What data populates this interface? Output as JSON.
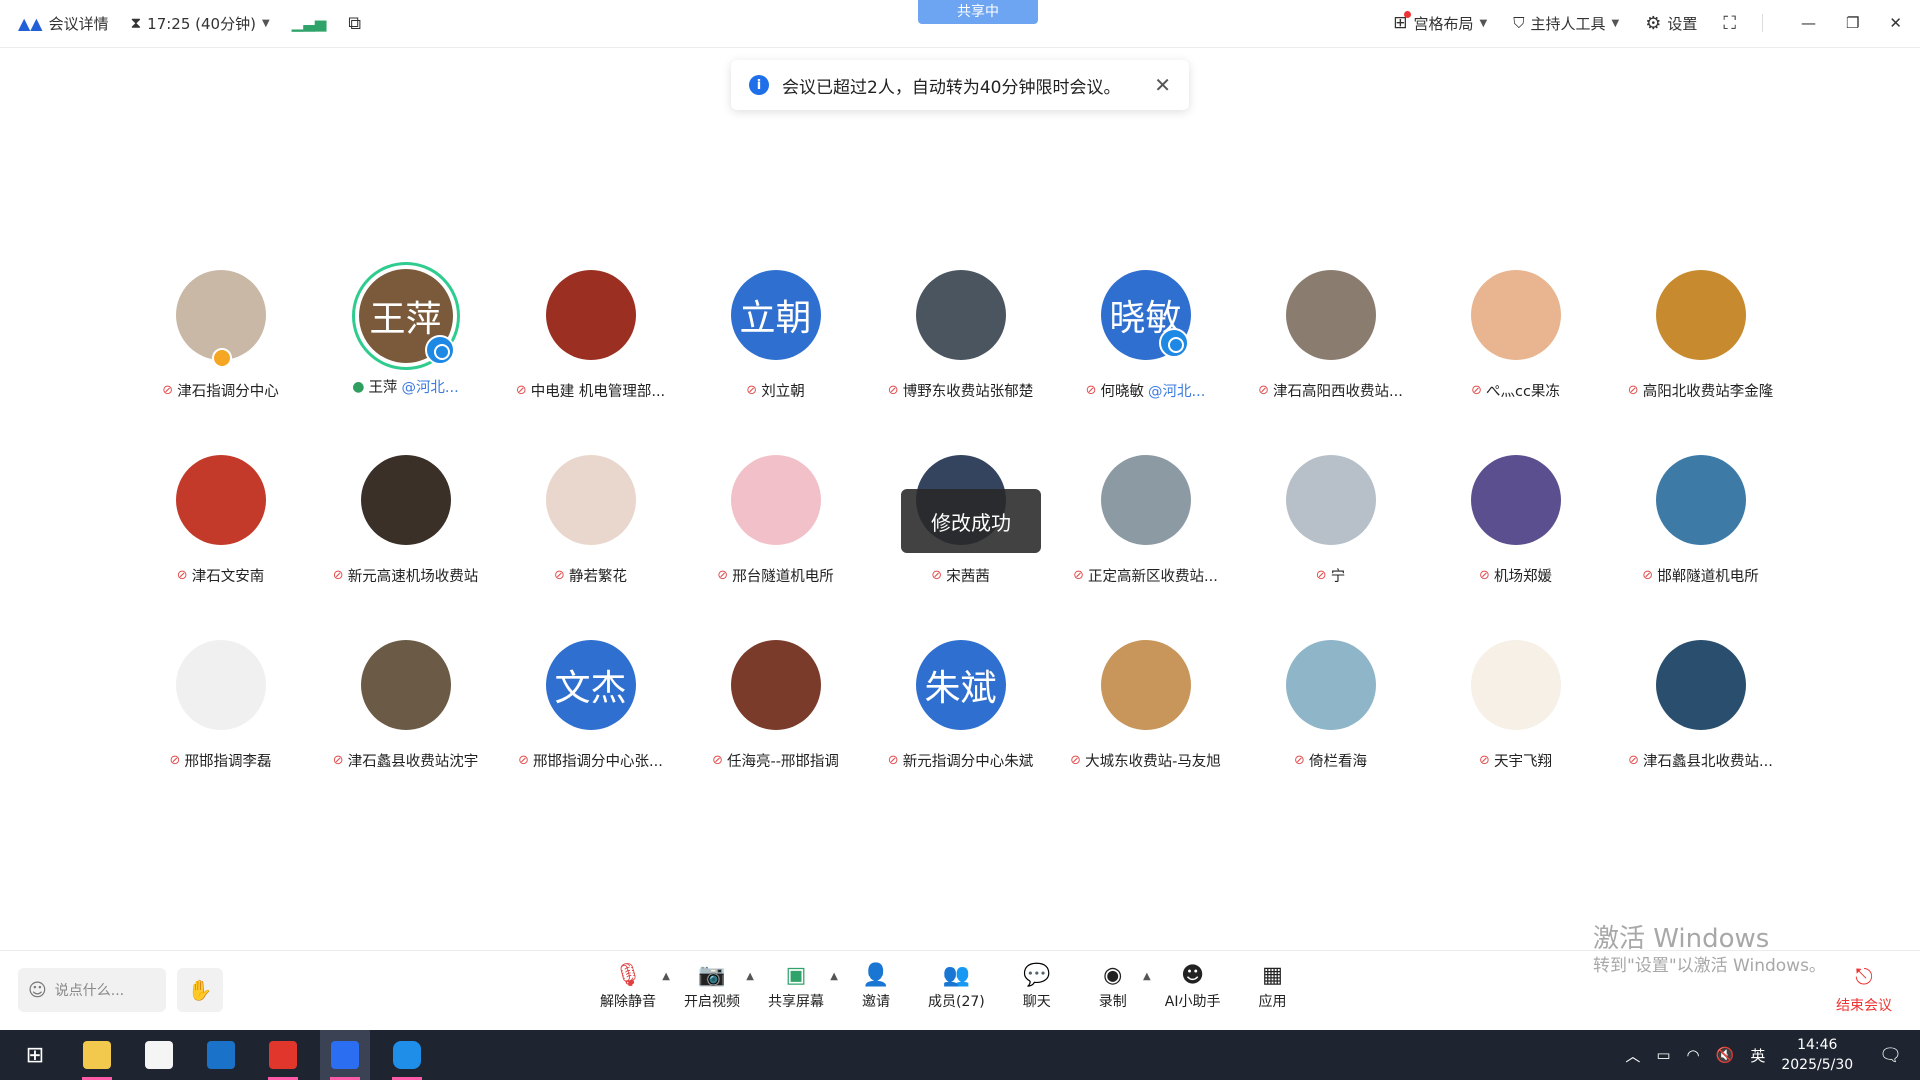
{
  "topbar": {
    "meeting_details": "会议详情",
    "timer": "17:25 (40分钟)",
    "sharing": "共享中",
    "layout": "宫格布局",
    "host_tools": "主持人工具",
    "settings": "设置"
  },
  "notice": {
    "text": "会议已超过2人，自动转为40分钟限时会议。"
  },
  "toast": "修改成功",
  "participants": [
    {
      "name": "津石指调分中心",
      "org": ""
    },
    {
      "name": "王萍",
      "org": "@河北...",
      "avatar_text": "王萍"
    },
    {
      "name": "中电建 机电管理部...",
      "org": ""
    },
    {
      "name": "刘立朝",
      "org": "",
      "avatar_text": "立朝"
    },
    {
      "name": "博野东收费站张郁楚",
      "org": ""
    },
    {
      "name": "何晓敏",
      "org": "@河北...",
      "avatar_text": "晓敏"
    },
    {
      "name": "津石高阳西收费站...",
      "org": ""
    },
    {
      "name": "ぺ灬cc果冻",
      "org": ""
    },
    {
      "name": "高阳北收费站李金隆",
      "org": ""
    },
    {
      "name": "津石文安南",
      "org": ""
    },
    {
      "name": "新元高速机场收费站",
      "org": ""
    },
    {
      "name": "静若繁花",
      "org": ""
    },
    {
      "name": "邢台隧道机电所",
      "org": ""
    },
    {
      "name": "宋茜茜",
      "org": ""
    },
    {
      "name": "正定高新区收费站...",
      "org": ""
    },
    {
      "name": "宁",
      "org": ""
    },
    {
      "name": "机场郑媛",
      "org": ""
    },
    {
      "name": "邯郸隧道机电所",
      "org": ""
    },
    {
      "name": "邢邯指调李磊",
      "org": ""
    },
    {
      "name": "津石蠡县收费站沈宇",
      "org": ""
    },
    {
      "name": "邢邯指调分中心张...",
      "org": "",
      "avatar_text": "文杰"
    },
    {
      "name": "任海亮--邢邯指调",
      "org": ""
    },
    {
      "name": "新元指调分中心朱斌",
      "org": "",
      "avatar_text": "朱斌"
    },
    {
      "name": "大城东收费站-马友旭",
      "org": ""
    },
    {
      "name": "倚栏看海",
      "org": ""
    },
    {
      "name": "天宇飞翔",
      "org": ""
    },
    {
      "name": "津石蠡县北收费站...",
      "org": ""
    }
  ],
  "toolbar": {
    "say_placeholder": "说点什么...",
    "unmute": "解除静音",
    "video": "开启视频",
    "share": "共享屏幕",
    "invite": "邀请",
    "members": "成员(27)",
    "chat": "聊天",
    "record": "录制",
    "ai": "AI小助手",
    "apps": "应用",
    "end": "结束会议"
  },
  "watermark": {
    "title": "激活 Windows",
    "sub": "转到\"设置\"以激活 Windows。"
  },
  "taskbar": {
    "ime": "英",
    "time": "14:46",
    "date": "2025/5/30"
  }
}
